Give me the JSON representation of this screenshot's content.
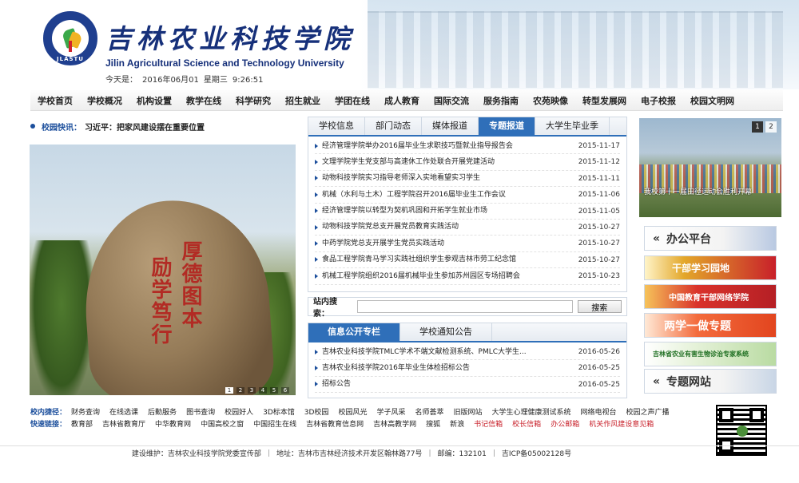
{
  "header": {
    "name_cn": "吉林农业科技学院",
    "name_en": "Jilin Agricultural Science and Technology University",
    "logo_text": "JLASTU",
    "date_label": "今天是：",
    "date": "2016年06月01",
    "weekday": "星期三",
    "time": "9:26:51"
  },
  "nav": [
    "学校首页",
    "学校概况",
    "机构设置",
    "教学在线",
    "科学研究",
    "招生就业",
    "学团在线",
    "成人教育",
    "国际交流",
    "服务指南",
    "农苑映像",
    "转型发展网",
    "电子校报",
    "校园文明网"
  ],
  "flash": {
    "label": "校园快讯：",
    "text": "习近平：把家风建设摆在重要位置"
  },
  "photo": {
    "inscription_right": "厚德图本",
    "inscription_left": "励学笃行",
    "pages": [
      "1",
      "2",
      "3",
      "4",
      "5",
      "6"
    ],
    "active": "1"
  },
  "news": {
    "tabs": [
      "学校信息",
      "部门动态",
      "媒体报道",
      "专题报道",
      "大学生毕业季"
    ],
    "active_tab": "专题报道",
    "items": [
      {
        "title": "经济管理学院举办2016届毕业生求职技巧暨就业指导报告会",
        "date": "2015-11-17"
      },
      {
        "title": "文理学院学生党支部与高速休工作处联合开展党建活动",
        "date": "2015-11-12"
      },
      {
        "title": "动物科技学院实习指导老师深入实地看望实习学生",
        "date": "2015-11-11"
      },
      {
        "title": "机械（水利与土木）工程学院召开2016届毕业生工作会议",
        "date": "2015-11-06"
      },
      {
        "title": "经济管理学院以转型为契机巩固和开拓学生就业市场",
        "date": "2015-11-05"
      },
      {
        "title": "动物科技学院党总支开展党员教育实践活动",
        "date": "2015-10-27"
      },
      {
        "title": "中药学院党总支开展学生党员实践活动",
        "date": "2015-10-27"
      },
      {
        "title": "食品工程学院青马学习实践社组织学生参观吉林市劳工纪念馆",
        "date": "2015-10-27"
      },
      {
        "title": "机械工程学院组织2016届机械毕业生参加苏州园区专场招聘会",
        "date": "2015-10-23"
      }
    ]
  },
  "search": {
    "label": "站内搜索：",
    "button": "搜索",
    "placeholder": ""
  },
  "info": {
    "tabs": [
      "信息公开专栏",
      "学校通知公告"
    ],
    "active_tab": "信息公开专栏",
    "items": [
      {
        "title": "吉林农业科技学院TMLC学术不端文献检测系统、PMLC大学生...",
        "date": "2016-05-26"
      },
      {
        "title": "吉林农业科技学院2016年毕业生体检招标公告",
        "date": "2016-05-25"
      },
      {
        "title": "招标公告",
        "date": "2016-05-25"
      }
    ]
  },
  "slide": {
    "caption": "我校第十一届田径运动会胜利开幕",
    "pages": [
      "1",
      "2"
    ],
    "active": "1"
  },
  "banners": [
    "办公平台",
    "干部学习园地",
    "中国教育干部网络学院",
    "两学一做专题",
    "吉林省农业有害生物诊治专家系统",
    "专题网站"
  ],
  "links": {
    "internal_label": "校内捷径：",
    "internal": [
      "财务查询",
      "在线选课",
      "后勤服务",
      "图书查询",
      "校园好人",
      "3D标本馆",
      "3D校园",
      "校园风光",
      "学子风采",
      "名师荟萃",
      "旧版网站",
      "大学生心理健康测试系统",
      "网络电视台",
      "校园之声广播"
    ],
    "quick_label": "快速链接：",
    "quick": [
      "教育部",
      "吉林省教育厅",
      "中华教育网",
      "中国高校之窗",
      "中国招生在线",
      "吉林省教育信息网",
      "吉林高教学网",
      "搜狐",
      "新浪"
    ],
    "quick_red": [
      "书记信箱",
      "校长信箱",
      "办公邮箱",
      "机关作风建设意见箱"
    ]
  },
  "footer": {
    "maintain": "建设维护：吉林农业科技学院党委宣传部",
    "address": "地址：吉林市吉林经济技术开发区翰林路77号",
    "postcode": "邮编：132101",
    "icp": "吉ICP备05002128号"
  }
}
